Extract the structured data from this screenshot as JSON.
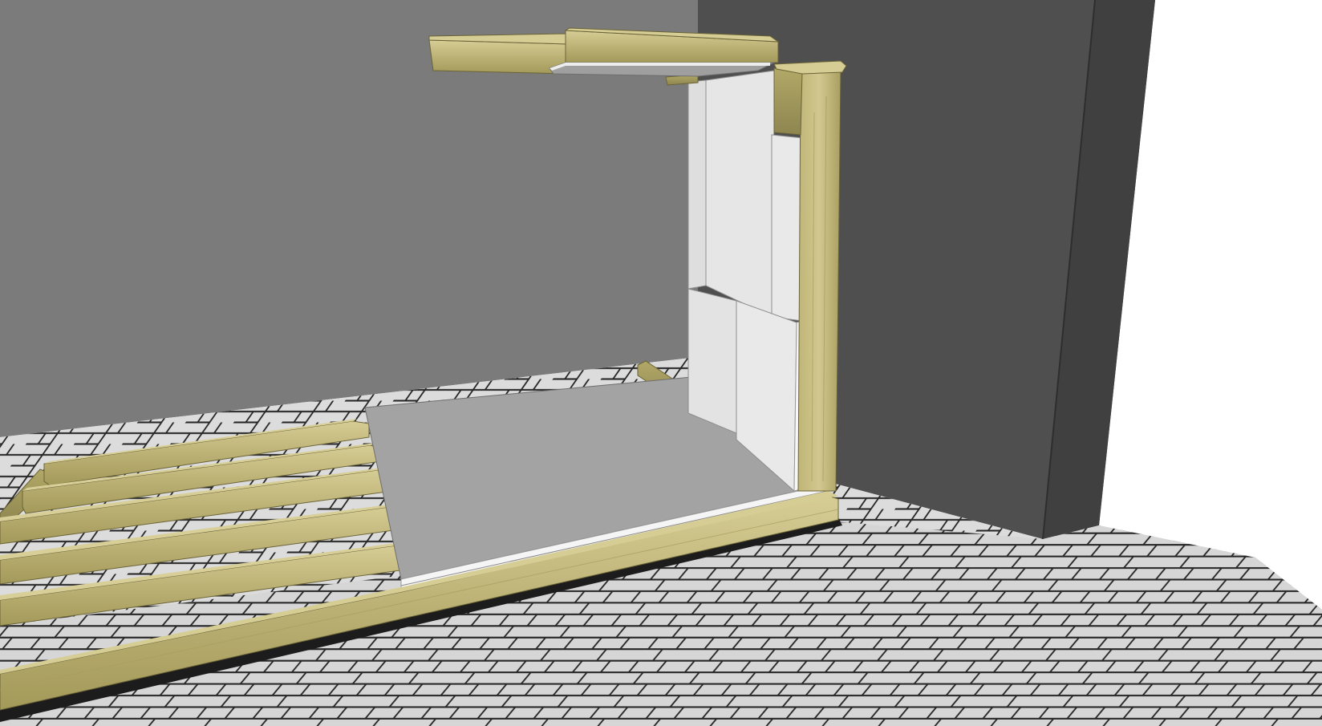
{
  "scene": {
    "colors": {
      "background": "#ffffff",
      "back_wall": "#7a7a7a",
      "side_wall": "#4f4f4f",
      "side_wall_edge": "#3a3a3a",
      "floor_tile": "#d9d9d9",
      "floor_grout": "#2b2b2b",
      "wood_light": "#c9bf86",
      "wood_mid": "#b3a96c",
      "wood_dark": "#8f8650",
      "panel": "#e4e4e4",
      "panel_shadow": "#cfcfcf",
      "floor_panel": "#a3a3a3",
      "floor_panel_edge": "#ffffff",
      "membrane": "#2a2a2a",
      "outline": "#1a1a1a"
    },
    "objects": [
      "back-wall",
      "side-wall",
      "paver-floor",
      "floor-joists",
      "sole-plate",
      "corner-post",
      "wall-panels",
      "floor-panel",
      "ceiling-beams",
      "ceiling-panel"
    ]
  }
}
